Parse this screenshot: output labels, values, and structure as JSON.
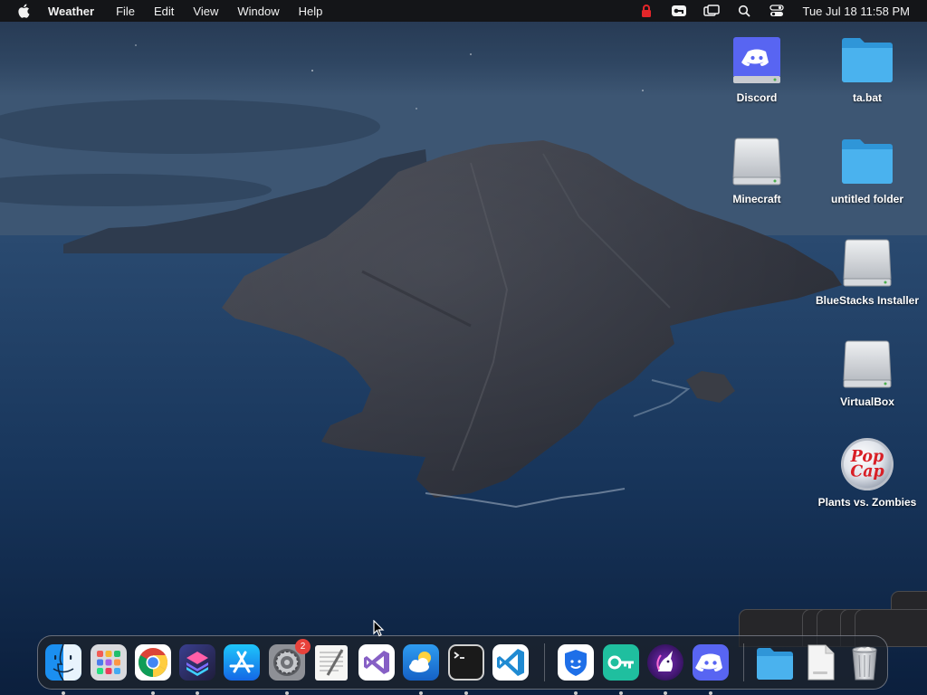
{
  "menubar": {
    "app_name": "Weather",
    "menus": [
      "File",
      "Edit",
      "View",
      "Window",
      "Help"
    ],
    "status_icons": [
      "lock-icon",
      "vpn-key-icon",
      "screen-mirroring-icon",
      "spotlight-search-icon",
      "control-center-icon"
    ],
    "clock": "Tue Jul 18  11:58 PM"
  },
  "desktop": {
    "icons": [
      {
        "label": "Discord",
        "kind": "discord-disk"
      },
      {
        "label": "ta.bat",
        "kind": "folder"
      },
      {
        "label": "Minecraft",
        "kind": "disk"
      },
      {
        "label": "untitled folder",
        "kind": "folder"
      },
      {
        "label": "BlueStacks Installer",
        "kind": "disk"
      },
      {
        "label": "VirtualBox",
        "kind": "disk"
      },
      {
        "label": "Plants vs. Zombies",
        "kind": "popcap"
      }
    ],
    "popcap_text": [
      "Pop",
      "Cap"
    ]
  },
  "dock": {
    "apps": [
      {
        "name": "Finder",
        "running": true
      },
      {
        "name": "Launchpad",
        "running": false
      },
      {
        "name": "Google Chrome",
        "running": true
      },
      {
        "name": "Shortcuts",
        "running": true
      },
      {
        "name": "App Store",
        "running": false
      },
      {
        "name": "System Settings",
        "running": true,
        "badge": "2"
      },
      {
        "name": "TextEdit",
        "running": false
      },
      {
        "name": "Visual Studio",
        "running": false
      },
      {
        "name": "Weather",
        "running": true
      },
      {
        "name": "Terminal",
        "running": true
      },
      {
        "name": "Visual Studio Code",
        "running": false
      },
      {
        "name": "Betternet VPN",
        "running": true
      },
      {
        "name": "Key VPN",
        "running": true
      },
      {
        "name": "Unicorn Browser",
        "running": true
      },
      {
        "name": "Discord",
        "running": true
      },
      {
        "name": "Downloads Folder",
        "running": false
      },
      {
        "name": "Document",
        "running": false
      },
      {
        "name": "Trash",
        "running": false
      }
    ]
  },
  "colors": {
    "menubar": "#141518",
    "folder_blue": "#3fa9e8",
    "discord_blurple": "#5865f2",
    "badge_red": "#e8423b"
  }
}
